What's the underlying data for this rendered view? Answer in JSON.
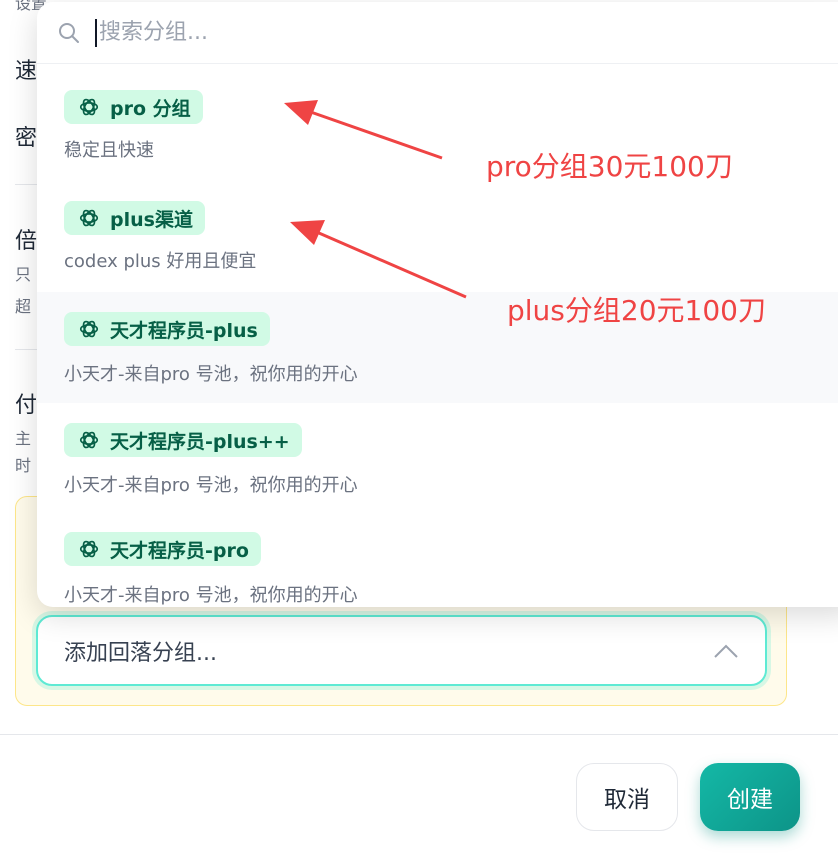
{
  "background": {
    "labels": [
      "速",
      "密",
      "倍",
      "只",
      "超",
      "付",
      "主",
      "时"
    ],
    "top_cut_text": "设置..."
  },
  "fallback": {
    "placeholder": "添加回落分组...",
    "chevron_icon": "chevron-up-icon"
  },
  "footer": {
    "cancel_label": "取消",
    "create_label": "创建"
  },
  "dropdown": {
    "search_placeholder": "搜索分组...",
    "search_icon": "search-icon",
    "options": [
      {
        "name": "pro 分组",
        "description": "稳定且快速",
        "icon": "openai-icon"
      },
      {
        "name": "plus渠道",
        "description": "codex plus 好用且便宜",
        "icon": "openai-icon"
      },
      {
        "name": "天才程序员-plus",
        "description": "小天才-来自pro 号池，祝你用的开心",
        "icon": "openai-icon"
      },
      {
        "name": "天才程序员-plus++",
        "description": "小天才-来自pro 号池，祝你用的开心",
        "icon": "openai-icon"
      },
      {
        "name": "天才程序员-pro",
        "description": "小天才-来自pro 号池，祝你用的开心",
        "icon": "openai-icon"
      }
    ]
  },
  "annotations": {
    "pro_note": "pro分组30元100刀",
    "plus_note": "plus分组20元100刀",
    "color": "#ef4444"
  },
  "colors": {
    "accent": "#0d9488",
    "tag_bg": "#d1fae5",
    "tag_text": "#065f46"
  }
}
